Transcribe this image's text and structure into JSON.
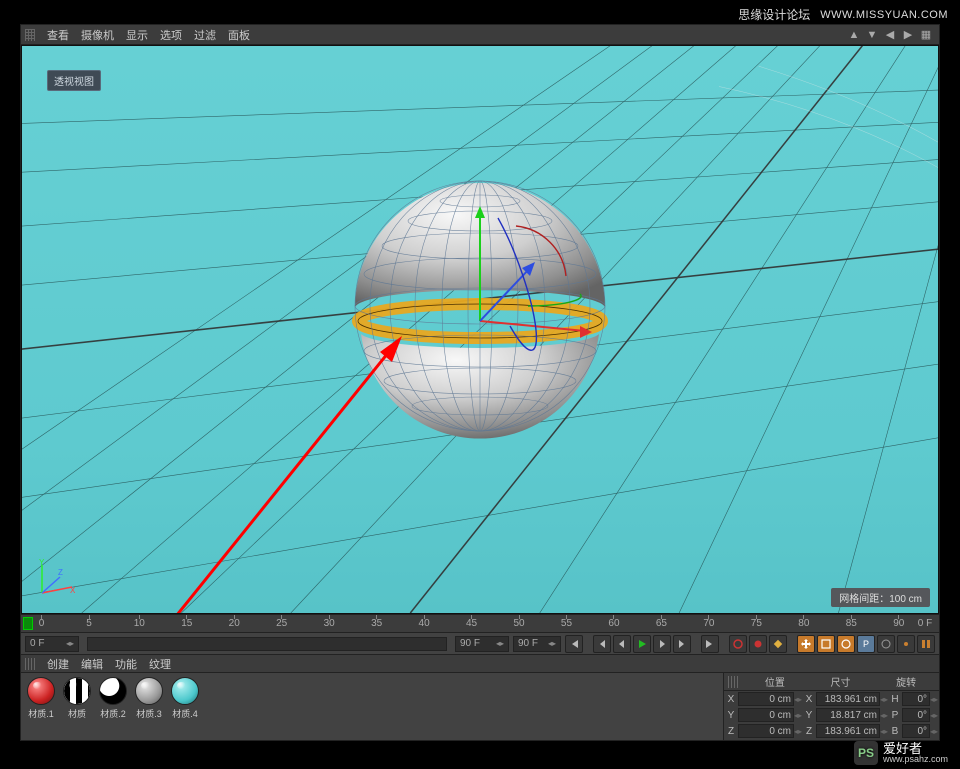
{
  "watermark": {
    "top_title": "思缘设计论坛",
    "top_url": "WWW.MISSYUAN.COM",
    "bottom_logo": "PS",
    "bottom_title": "爱好者",
    "bottom_url": "www.psahz.com"
  },
  "view_menu": {
    "items": [
      "查看",
      "摄像机",
      "显示",
      "选项",
      "过滤",
      "面板"
    ]
  },
  "viewport": {
    "tag": "透视视图",
    "grid_info": "网格间距：100 cm"
  },
  "timeline": {
    "ticks": [
      "0",
      "5",
      "10",
      "15",
      "20",
      "25",
      "30",
      "35",
      "40",
      "45",
      "50",
      "55",
      "60",
      "65",
      "70",
      "75",
      "80",
      "85",
      "90"
    ],
    "end_label": "0 F",
    "frame_start": "0 F",
    "frame_end": "90 F",
    "frame_end2": "90 F"
  },
  "material_menu": {
    "items": [
      "创建",
      "编辑",
      "功能",
      "纹理"
    ]
  },
  "materials": [
    {
      "type": "red",
      "label": "材质.1"
    },
    {
      "type": "stripe",
      "label": "材质"
    },
    {
      "type": "bw",
      "label": "材质.2"
    },
    {
      "type": "grey",
      "label": "材质.3"
    },
    {
      "type": "cyan",
      "label": "材质.4"
    }
  ],
  "coord": {
    "headers": [
      "位置",
      "尺寸",
      "旋转"
    ],
    "rows": [
      {
        "axis": "X",
        "pos": "0 cm",
        "sizeLbl": "X",
        "size": "183.961 cm",
        "rotLbl": "H",
        "rot": "0°"
      },
      {
        "axis": "Y",
        "pos": "0 cm",
        "sizeLbl": "Y",
        "size": "18.817 cm",
        "rotLbl": "P",
        "rot": "0°"
      },
      {
        "axis": "Z",
        "pos": "0 cm",
        "sizeLbl": "Z",
        "size": "183.961 cm",
        "rotLbl": "B",
        "rot": "0°"
      }
    ]
  }
}
